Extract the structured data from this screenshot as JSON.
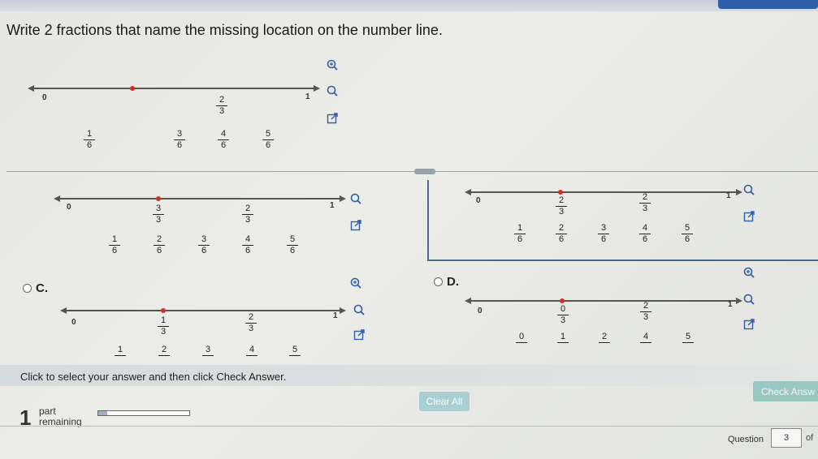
{
  "question": {
    "prompt": "Write 2 fractions that name the missing location on the number line."
  },
  "problem_line": {
    "start_label": "0",
    "end_label": "1",
    "top_fracs": [
      {
        "n": "2",
        "d": "3"
      }
    ],
    "bottom_fracs": [
      {
        "n": "1",
        "d": "6"
      },
      {
        "n": "3",
        "d": "6"
      },
      {
        "n": "4",
        "d": "6"
      },
      {
        "n": "5",
        "d": "6"
      }
    ]
  },
  "option_b": {
    "start_label": "0",
    "end_label": "1",
    "top_fracs": [
      {
        "n": "3",
        "d": "3"
      },
      {
        "n": "2",
        "d": "3"
      }
    ],
    "bottom_fracs": [
      {
        "n": "1",
        "d": "6"
      },
      {
        "n": "2",
        "d": "6"
      },
      {
        "n": "3",
        "d": "6"
      },
      {
        "n": "4",
        "d": "6"
      },
      {
        "n": "5",
        "d": "6"
      }
    ]
  },
  "option_a": {
    "start_label": "0",
    "end_label": "1",
    "top_fracs": [
      {
        "n": "2",
        "d": "3"
      },
      {
        "n": "2",
        "d": "3"
      }
    ],
    "bottom_fracs": [
      {
        "n": "1",
        "d": "6"
      },
      {
        "n": "2",
        "d": "6"
      },
      {
        "n": "3",
        "d": "6"
      },
      {
        "n": "4",
        "d": "6"
      },
      {
        "n": "5",
        "d": "6"
      }
    ]
  },
  "option_c": {
    "label": "C.",
    "start_label": "0",
    "end_label": "1",
    "top_fracs": [
      {
        "n": "1",
        "d": "3"
      },
      {
        "n": "2",
        "d": "3"
      }
    ],
    "bottom_nums": [
      "1",
      "2",
      "3",
      "4",
      "5"
    ]
  },
  "option_d": {
    "label": "D.",
    "start_label": "0",
    "end_label": "1",
    "top_fracs": [
      {
        "n": "0",
        "d": "3"
      },
      {
        "n": "2",
        "d": "3"
      }
    ],
    "bottom_nums": [
      "0",
      "1",
      "2",
      "4",
      "5"
    ]
  },
  "footer": {
    "instruction": "Click to select your answer and then click Check Answer.",
    "parts_count": "1",
    "parts_word": "part",
    "remaining_word": "remaining",
    "progress": 0.1,
    "clear_all": "Clear All",
    "check_answer": "Check Answ",
    "question_label": "Question",
    "question_number": "3",
    "of_label": "of"
  },
  "icons": {
    "zoom_in": "zoom-in-icon",
    "zoom_out": "zoom-out-icon",
    "popout": "popout-icon"
  }
}
